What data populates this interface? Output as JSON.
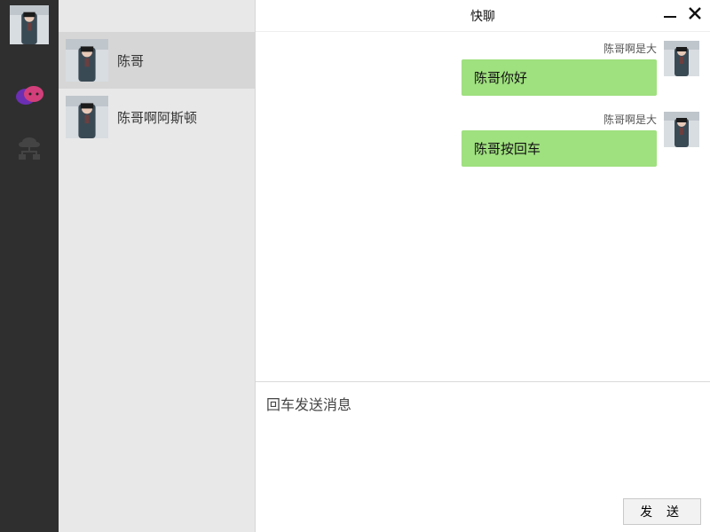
{
  "app": {
    "title": "快聊"
  },
  "window": {
    "minimize_label": "最小化",
    "close_label": "关闭"
  },
  "rail": {
    "avatar_icon": "user-avatar",
    "nav": [
      {
        "name": "chat-icon"
      },
      {
        "name": "network-icon"
      }
    ]
  },
  "contacts": {
    "items": [
      {
        "name": "陈哥",
        "selected": true
      },
      {
        "name": "陈哥啊阿斯顿",
        "selected": false
      }
    ]
  },
  "chat": {
    "messages": [
      {
        "sender": "陈哥啊是大",
        "text": "陈哥你好",
        "mine": true
      },
      {
        "sender": "陈哥啊是大",
        "text": "陈哥按回车",
        "mine": true
      }
    ]
  },
  "composer": {
    "placeholder": "回车发送消息",
    "value": "",
    "send_label": "发 送"
  },
  "colors": {
    "rail_bg": "#2f2f2f",
    "contacts_bg": "#e8e8e8",
    "contacts_selected": "#d6d6d6",
    "bubble_bg": "#9fe07f"
  }
}
